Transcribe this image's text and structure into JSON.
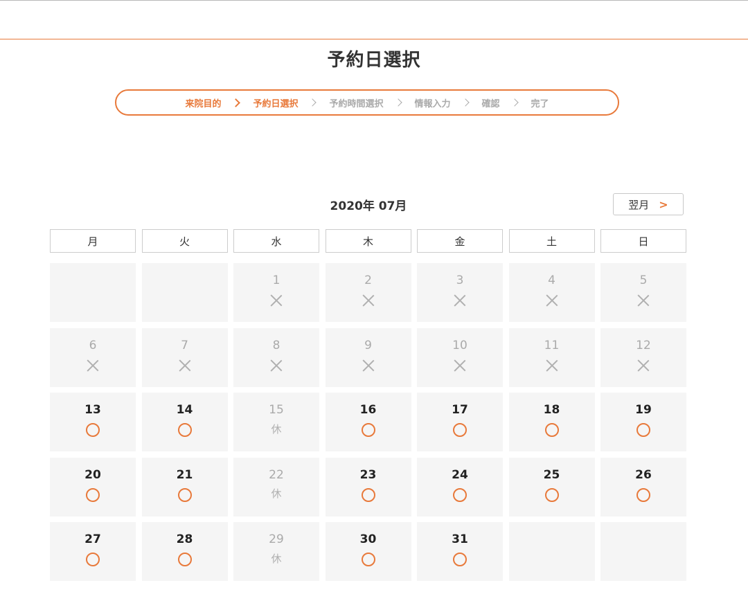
{
  "page_title": "予約日選択",
  "steps": [
    {
      "label": "来院目的",
      "active": true
    },
    {
      "label": "予約日選択",
      "active": true
    },
    {
      "label": "予約時間選択",
      "active": false
    },
    {
      "label": "情報入力",
      "active": false
    },
    {
      "label": "確認",
      "active": false
    },
    {
      "label": "完了",
      "active": false
    }
  ],
  "calendar": {
    "month_label": "2020年 07月",
    "next_button_label": "翌月",
    "next_button_arrow": ">",
    "weekdays": [
      "月",
      "火",
      "水",
      "木",
      "金",
      "土",
      "日"
    ],
    "holiday_label": "休",
    "days": [
      {
        "day": "",
        "status": "empty"
      },
      {
        "day": "",
        "status": "empty"
      },
      {
        "day": "1",
        "status": "unavailable"
      },
      {
        "day": "2",
        "status": "unavailable"
      },
      {
        "day": "3",
        "status": "unavailable"
      },
      {
        "day": "4",
        "status": "unavailable"
      },
      {
        "day": "5",
        "status": "unavailable"
      },
      {
        "day": "6",
        "status": "unavailable"
      },
      {
        "day": "7",
        "status": "unavailable"
      },
      {
        "day": "8",
        "status": "unavailable"
      },
      {
        "day": "9",
        "status": "unavailable"
      },
      {
        "day": "10",
        "status": "unavailable"
      },
      {
        "day": "11",
        "status": "unavailable"
      },
      {
        "day": "12",
        "status": "unavailable"
      },
      {
        "day": "13",
        "status": "available"
      },
      {
        "day": "14",
        "status": "available"
      },
      {
        "day": "15",
        "status": "holiday"
      },
      {
        "day": "16",
        "status": "available"
      },
      {
        "day": "17",
        "status": "available"
      },
      {
        "day": "18",
        "status": "available"
      },
      {
        "day": "19",
        "status": "available"
      },
      {
        "day": "20",
        "status": "available"
      },
      {
        "day": "21",
        "status": "available"
      },
      {
        "day": "22",
        "status": "holiday"
      },
      {
        "day": "23",
        "status": "available"
      },
      {
        "day": "24",
        "status": "available"
      },
      {
        "day": "25",
        "status": "available"
      },
      {
        "day": "26",
        "status": "available"
      },
      {
        "day": "27",
        "status": "available"
      },
      {
        "day": "28",
        "status": "available"
      },
      {
        "day": "29",
        "status": "holiday"
      },
      {
        "day": "30",
        "status": "available"
      },
      {
        "day": "31",
        "status": "available"
      },
      {
        "day": "",
        "status": "empty"
      },
      {
        "day": "",
        "status": "empty"
      }
    ]
  },
  "colors": {
    "accent": "#e8793a",
    "muted": "#aaaaaa",
    "cell_bg": "#f5f5f5"
  },
  "icons": {
    "available": "circle-icon",
    "unavailable": "cross-icon",
    "next": "chevron-right-icon"
  }
}
